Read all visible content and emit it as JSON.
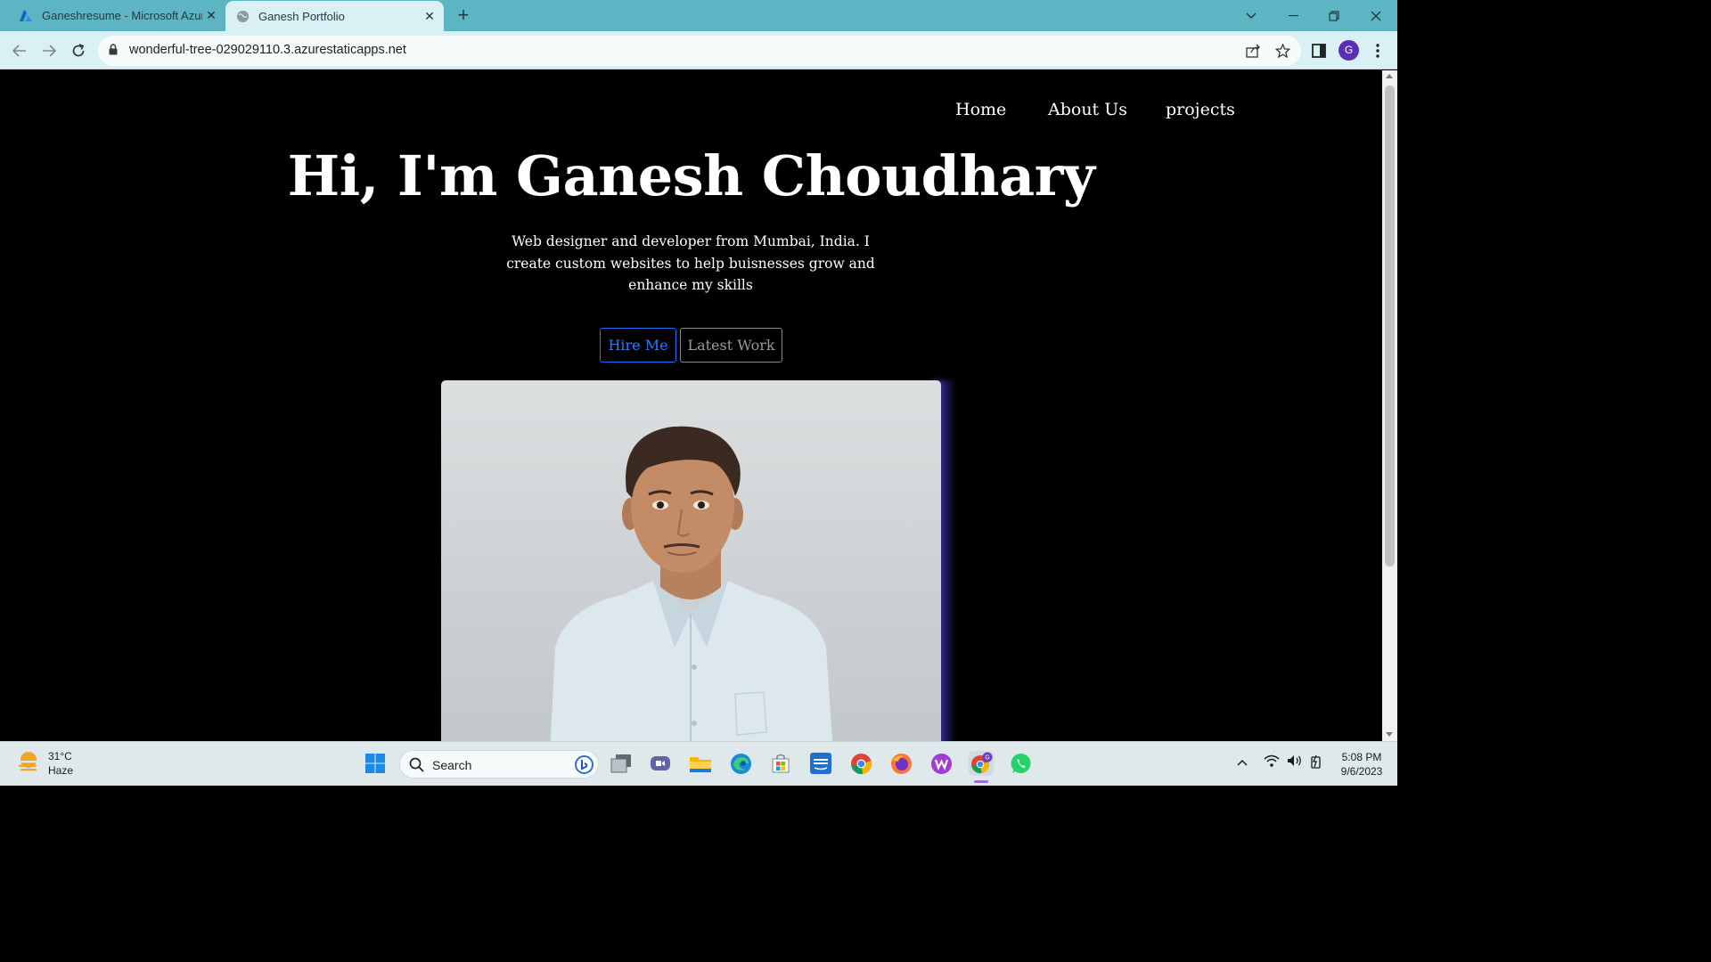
{
  "browser": {
    "tabs": [
      {
        "title": "Ganeshresume - Microsoft Azure",
        "icon": "azure-icon",
        "active": false
      },
      {
        "title": "Ganesh Portfolio",
        "icon": "globe-icon",
        "active": true
      }
    ],
    "url": "wonderful-tree-029029110.3.azurestaticapps.net",
    "profile_initial": "G"
  },
  "page": {
    "nav": {
      "home": "Home",
      "about": "About Us",
      "projects": "projects"
    },
    "hero": {
      "title": "Hi, I'm Ganesh Choudhary",
      "subtitle": "Web designer and developer from Mumbai, India. I create custom websites to help buisnesses grow and enhance my skills",
      "hire_button": "Hire Me",
      "work_button": "Latest Work"
    },
    "colors": {
      "hire_accent": "#2a7bff",
      "photo_glow": "#4b3fc4",
      "background": "#000000"
    }
  },
  "taskbar": {
    "weather": {
      "temp": "31°C",
      "condition": "Haze"
    },
    "search_label": "Search",
    "clock": {
      "time": "5:08 PM",
      "date": "9/6/2023"
    }
  }
}
